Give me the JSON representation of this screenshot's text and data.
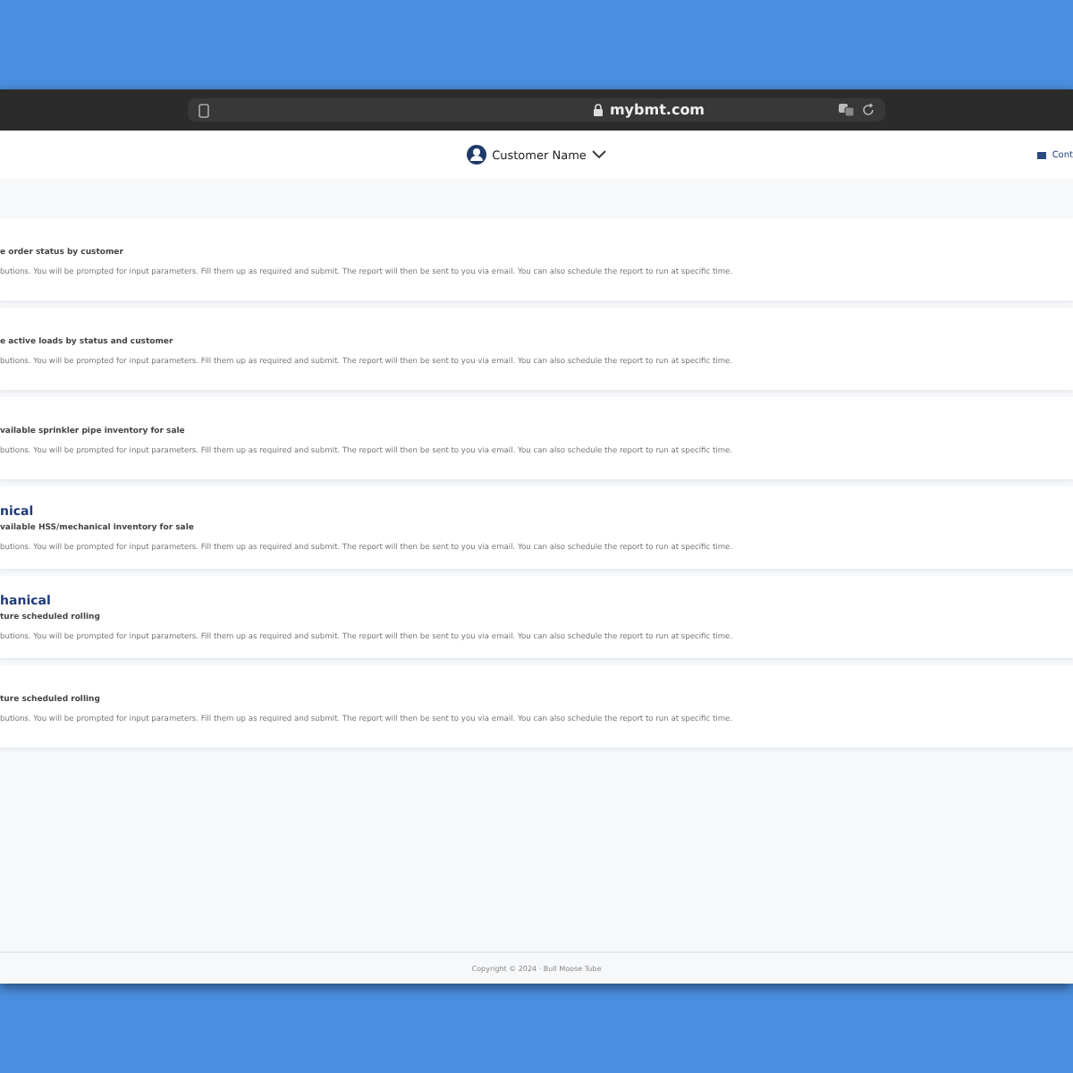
{
  "browser": {
    "address": "mybmt.com"
  },
  "header": {
    "user": "Customer Name",
    "contact": "Cont"
  },
  "reports": [
    {
      "subtitle": "e order status by customer",
      "description": "butions. You will be prompted for input parameters. Fill them up as required and submit. The report will then be sent to you via email. You can also schedule the report to run at specific time."
    },
    {
      "subtitle": "e active loads by status and customer",
      "description": "butions. You will be prompted for input parameters. Fill them up as required and submit. The report will then be sent to you via email. You can also schedule the report to run at specific time."
    },
    {
      "subtitle": "vailable sprinkler pipe inventory for sale",
      "description": "butions. You will be prompted for input parameters. Fill them up as required and submit. The report will then be sent to you via email. You can also schedule the report to run at specific time."
    },
    {
      "title": "nical",
      "subtitle": "vailable HSS/mechanical inventory for sale",
      "description": "butions. You will be prompted for input parameters. Fill them up as required and submit. The report will then be sent to you via email. You can also schedule the report to run at specific time."
    },
    {
      "title": "hanical",
      "subtitle": "ture scheduled rolling",
      "description": "butions. You will be prompted for input parameters. Fill them up as required and submit. The report will then be sent to you via email. You can also schedule the report to run at specific time."
    },
    {
      "subtitle": "ture scheduled rolling",
      "description": "butions. You will be prompted for input parameters. Fill them up as required and submit. The report will then be sent to you via email. You can also schedule the report to run at specific time."
    }
  ],
  "footer": "Copyright © 2024 · Bull Moose Tube"
}
